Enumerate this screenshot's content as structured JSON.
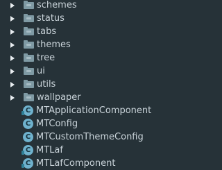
{
  "tree": {
    "folders": [
      {
        "label": "schemes",
        "icon": "folder-icon",
        "expand_icon": "chevron-right-icon"
      },
      {
        "label": "status",
        "icon": "folder-icon",
        "expand_icon": "chevron-right-icon"
      },
      {
        "label": "tabs",
        "icon": "folder-icon",
        "expand_icon": "chevron-right-icon"
      },
      {
        "label": "themes",
        "icon": "folder-icon",
        "expand_icon": "chevron-right-icon"
      },
      {
        "label": "tree",
        "icon": "folder-icon",
        "expand_icon": "chevron-right-icon"
      },
      {
        "label": "ui",
        "icon": "folder-icon",
        "expand_icon": "chevron-right-icon"
      },
      {
        "label": "utils",
        "icon": "folder-icon",
        "expand_icon": "chevron-right-icon"
      },
      {
        "label": "wallpaper",
        "icon": "folder-icon",
        "expand_icon": "chevron-right-icon"
      }
    ],
    "classes": [
      {
        "label": "MTApplicationComponent",
        "icon": "class-icon",
        "glyph": "C"
      },
      {
        "label": "MTConfig",
        "icon": "class-icon",
        "glyph": "C"
      },
      {
        "label": "MTCustomThemeConfig",
        "icon": "class-icon",
        "glyph": "C"
      },
      {
        "label": "MTLaf",
        "icon": "class-icon",
        "glyph": "C"
      },
      {
        "label": "MTLafComponent",
        "icon": "class-icon",
        "glyph": "C"
      }
    ]
  },
  "colors": {
    "background": "#263238",
    "text": "#c9d3d9",
    "folder": "#7f9aa4",
    "class_icon": "#6fb2cd",
    "expand_arrow": "#e9eef1"
  }
}
